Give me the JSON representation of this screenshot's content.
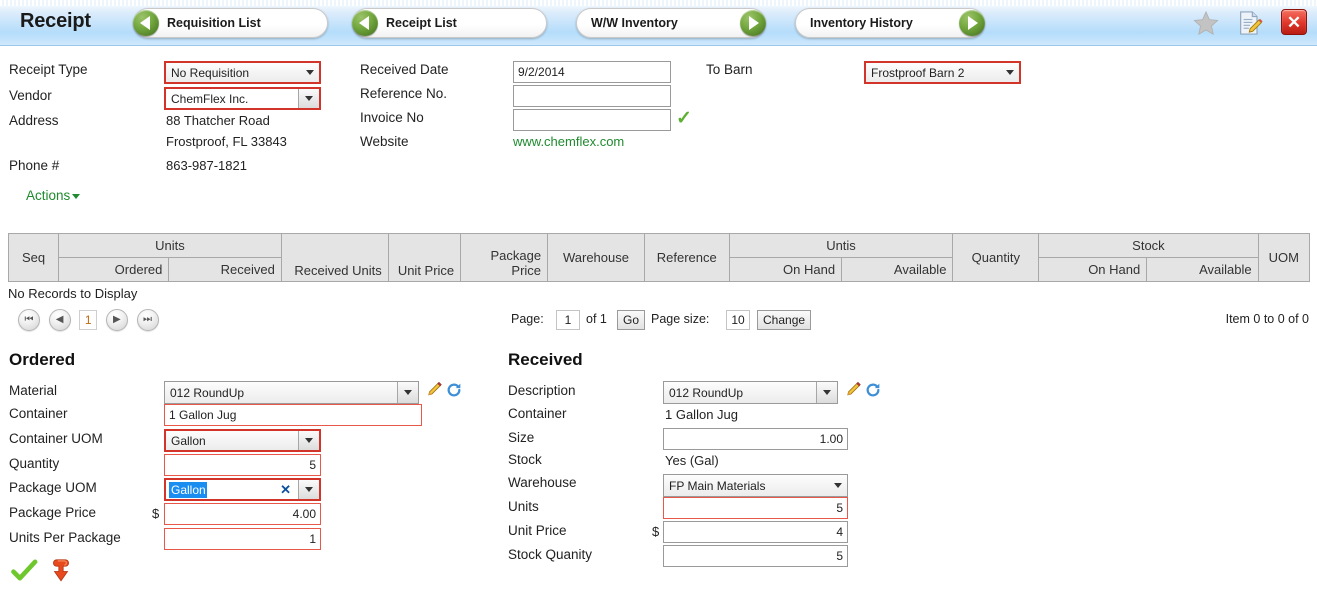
{
  "header": {
    "title": "Receipt",
    "nav": [
      {
        "label": "Requisition List",
        "dir": "left"
      },
      {
        "label": "Receipt List",
        "dir": "left"
      },
      {
        "label": "W/W Inventory",
        "dir": "right"
      },
      {
        "label": "Inventory History",
        "dir": "right"
      }
    ],
    "icons": {
      "favorite": "star-icon",
      "notes": "document-edit-icon",
      "close": "✕"
    }
  },
  "form": {
    "receipt_type_label": "Receipt Type",
    "receipt_type_value": "No Requisition",
    "vendor_label": "Vendor",
    "vendor_value": "ChemFlex Inc.",
    "address_label": "Address",
    "address_line1": "88 Thatcher Road",
    "address_line2": "Frostproof, FL 33843",
    "phone_label": "Phone #",
    "phone_value": "863-987-1821",
    "actions_label": "Actions",
    "received_date_label": "Received Date",
    "received_date_value": "9/2/2014",
    "reference_no_label": "Reference No.",
    "reference_no_value": "",
    "invoice_no_label": "Invoice No",
    "invoice_no_value": "",
    "website_label": "Website",
    "website_value": "www.chemflex.com",
    "to_barn_label": "To Barn",
    "to_barn_value": "Frostproof Barn 2"
  },
  "grid": {
    "columns": {
      "seq": "Seq",
      "units_group": "Units",
      "units_ordered": "Ordered",
      "units_received": "Received",
      "received_units": "Received Units",
      "unit_price": "Unit Price",
      "package_price": "Package Price",
      "warehouse": "Warehouse",
      "reference": "Reference",
      "untis_group": "Untis",
      "untis_onhand": "On Hand",
      "untis_available": "Available",
      "quantity": "Quantity",
      "stock_group": "Stock",
      "stock_onhand": "On Hand",
      "stock_available": "Available",
      "uom": "UOM"
    },
    "empty_message": "No Records to Display"
  },
  "pager": {
    "page_label": "Page:",
    "page_value": "1",
    "of_text": "of 1",
    "go_label": "Go",
    "page_size_label": "Page size:",
    "page_size_value": "10",
    "change_label": "Change",
    "current_page": "1",
    "item_count": "Item 0 to 0 of 0"
  },
  "ordered": {
    "heading": "Ordered",
    "material_label": "Material",
    "material_value": "012 RoundUp",
    "container_label": "Container",
    "container_value": "1 Gallon Jug",
    "container_uom_label": "Container UOM",
    "container_uom_value": "Gallon",
    "quantity_label": "Quantity",
    "quantity_value": "5",
    "package_uom_label": "Package UOM",
    "package_uom_value": "Gallon",
    "package_uom_clear": "✕",
    "package_price_label": "Package Price",
    "package_price_currency": "$",
    "package_price_value": "4.00",
    "units_per_package_label": "Units Per Package",
    "units_per_package_value": "1"
  },
  "received": {
    "heading": "Received",
    "description_label": "Description",
    "description_value": "012 RoundUp",
    "container_label": "Container",
    "container_value": "1 Gallon Jug",
    "size_label": "Size",
    "size_value": "1.00",
    "stock_label": "Stock",
    "stock_value": "Yes (Gal)",
    "warehouse_label": "Warehouse",
    "warehouse_value": "FP Main Materials",
    "units_label": "Units",
    "units_value": "5",
    "unit_price_label": "Unit Price",
    "unit_price_currency": "$",
    "unit_price_value": "4",
    "stock_quantity_label": "Stock Quanity",
    "stock_quantity_value": "5"
  },
  "colors": {
    "accent_green": "#1f8a2f",
    "error_red": "#d2342a",
    "header_blue": "#b4ddfb"
  }
}
